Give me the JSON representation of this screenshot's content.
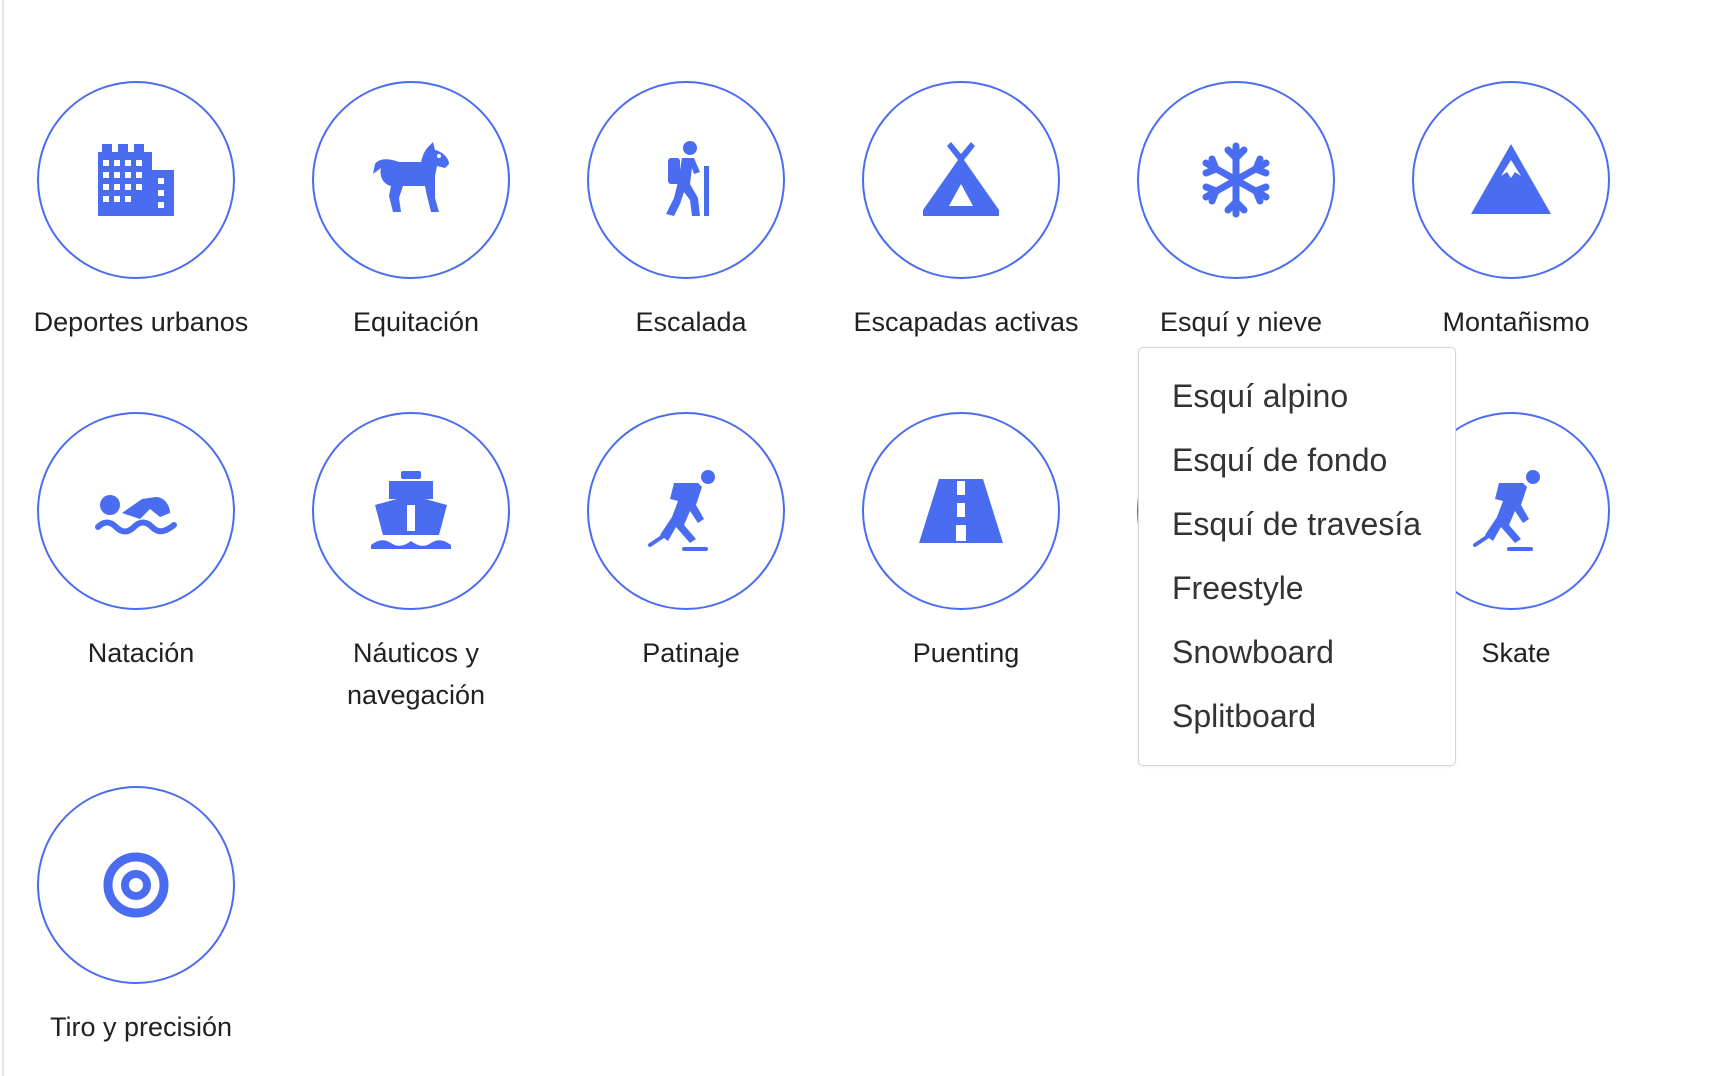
{
  "accent_color": "#4a6cf0",
  "categories": [
    {
      "label": "Deportes urbanos",
      "icon": "city-buildings-icon"
    },
    {
      "label": "Equitación",
      "icon": "horse-icon"
    },
    {
      "label": "Escalada",
      "icon": "hiker-icon"
    },
    {
      "label": "Escapadas activas",
      "icon": "tent-icon"
    },
    {
      "label": "Esquí y nieve",
      "icon": "snowflake-icon"
    },
    {
      "label": "Montañismo",
      "icon": "mountain-icon"
    },
    {
      "label": "Natación",
      "icon": "swimmer-icon"
    },
    {
      "label": "Náuticos y navegación",
      "icon": "ship-icon"
    },
    {
      "label": "Patinaje",
      "icon": "skater-icon"
    },
    {
      "label": "Puenting",
      "icon": "road-icon"
    },
    {
      "label": "",
      "icon": "hidden-by-dropdown"
    },
    {
      "label": "Skate",
      "icon": "skater-icon"
    },
    {
      "label": "Tiro y precisión",
      "icon": "target-icon"
    }
  ],
  "dropdown": {
    "parent": "Esquí y nieve",
    "items": [
      "Esquí alpino",
      "Esquí de fondo",
      "Esquí de travesía",
      "Freestyle",
      "Snowboard",
      "Splitboard"
    ]
  }
}
